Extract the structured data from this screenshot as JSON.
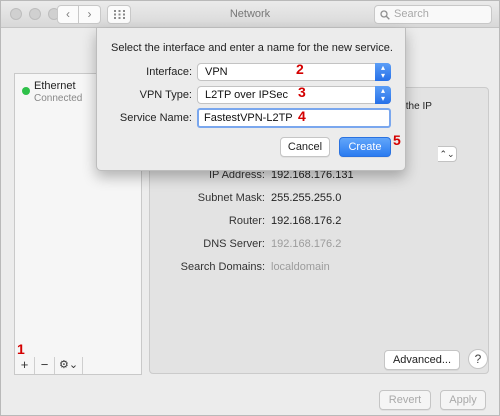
{
  "window": {
    "title": "Network",
    "search_placeholder": "Search"
  },
  "sidebar": {
    "services": [
      {
        "name": "Ethernet",
        "status": "Connected",
        "status_color": "#2fc14a"
      }
    ],
    "tools": {
      "add": "+",
      "remove": "−",
      "gear": "⚙⌄"
    }
  },
  "annotations": {
    "m1": "1",
    "m2": "2",
    "m3": "3",
    "m4": "4",
    "m5": "5"
  },
  "panel": {
    "partial_text": "s the IP",
    "ip_label": "IP Address:",
    "ip_value": "192.168.176.131",
    "mask_label": "Subnet Mask:",
    "mask_value": "255.255.255.0",
    "router_label": "Router:",
    "router_value": "192.168.176.2",
    "dns_label": "DNS Server:",
    "dns_value": "192.168.176.2",
    "domains_label": "Search Domains:",
    "domains_value": "localdomain",
    "advanced_button": "Advanced...",
    "help_button": "?",
    "revert_button": "Revert",
    "apply_button": "Apply"
  },
  "sheet": {
    "title": "Select the interface and enter a name for the new service.",
    "interface_label": "Interface:",
    "interface_value": "VPN",
    "vpn_type_label": "VPN Type:",
    "vpn_type_value": "L2TP over IPSec",
    "service_name_label": "Service Name:",
    "service_name_value": "FastestVPN-L2TP",
    "cancel_button": "Cancel",
    "create_button": "Create",
    "accent_color": "#2a7bf0"
  }
}
